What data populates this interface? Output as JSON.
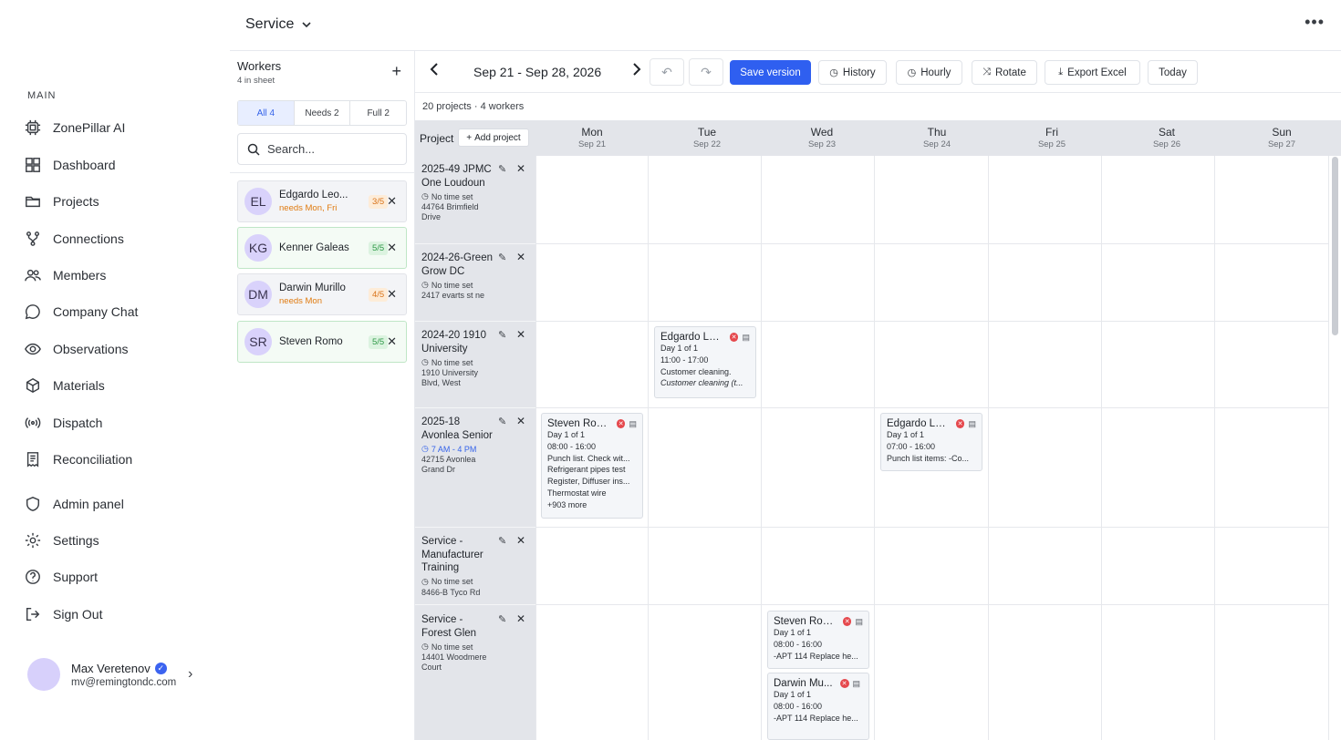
{
  "sidebar": {
    "section_label": "MAIN",
    "items": [
      {
        "label": "ZonePillar AI",
        "icon": "chip-icon"
      },
      {
        "label": "Dashboard",
        "icon": "grid-icon"
      },
      {
        "label": "Projects",
        "icon": "folder-icon"
      },
      {
        "label": "Connections",
        "icon": "branch-icon"
      },
      {
        "label": "Members",
        "icon": "people-icon"
      },
      {
        "label": "Company Chat",
        "icon": "chat-icon"
      },
      {
        "label": "Observations",
        "icon": "eye-icon"
      },
      {
        "label": "Materials",
        "icon": "box-icon"
      },
      {
        "label": "Dispatch",
        "icon": "broadcast-icon"
      },
      {
        "label": "Reconciliation",
        "icon": "receipt-icon"
      },
      {
        "label": "Admin panel",
        "icon": "shield-icon"
      },
      {
        "label": "Settings",
        "icon": "gear-icon"
      },
      {
        "label": "Support",
        "icon": "help-icon"
      },
      {
        "label": "Sign Out",
        "icon": "logout-icon"
      }
    ],
    "user": {
      "name": "Max Veretenov",
      "email": "mv@remingtondc.com"
    }
  },
  "header": {
    "title": "Service",
    "more": "•••"
  },
  "workers": {
    "title": "Workers",
    "subtitle": "4 in sheet",
    "filters": [
      "All 4",
      "Needs 2",
      "Full 2"
    ],
    "search_placeholder": "Search...",
    "list": [
      {
        "initials": "EL",
        "name": "Edgardo Leo...",
        "needs": "needs Mon, Fri",
        "badge": "3/5",
        "status": "warn"
      },
      {
        "initials": "KG",
        "name": "Kenner Galeas",
        "needs": "",
        "badge": "5/5",
        "status": "ok"
      },
      {
        "initials": "DM",
        "name": "Darwin Murillo",
        "needs": "needs Mon",
        "badge": "4/5",
        "status": "warn"
      },
      {
        "initials": "SR",
        "name": "Steven Romo",
        "needs": "",
        "badge": "5/5",
        "status": "ok"
      }
    ]
  },
  "toolbar": {
    "range": "Sep 21 - Sep 28, 2026",
    "save_label": "Save version",
    "history_label": "History",
    "hourly_label": "Hourly",
    "rotate_label": "Rotate",
    "export_label": "Export Excel",
    "today_label": "Today"
  },
  "summary": "20 projects · 4 workers",
  "grid": {
    "project_header": "Project",
    "add_project": "Add project",
    "days": [
      {
        "day": "Mon",
        "date": "Sep 21"
      },
      {
        "day": "Tue",
        "date": "Sep 22"
      },
      {
        "day": "Wed",
        "date": "Sep 23"
      },
      {
        "day": "Thu",
        "date": "Sep 24"
      },
      {
        "day": "Fri",
        "date": "Sep 25"
      },
      {
        "day": "Sat",
        "date": "Sep 26"
      },
      {
        "day": "Sun",
        "date": "Sep 27"
      }
    ],
    "projects": [
      {
        "name": "2025-49 JPMC One Loudoun",
        "time": "No time set",
        "address": "44764 Brimfield Drive"
      },
      {
        "name": "2024-26-Green Grow DC",
        "time": "No time set",
        "address": "2417 evarts st ne"
      },
      {
        "name": "2024-20 1910 University",
        "time": "No time set",
        "address": "1910 University Blvd, West"
      },
      {
        "name": "2025-18 Avonlea Senior",
        "time": "7 AM - 4 PM",
        "address": "42715 Avonlea Grand Dr"
      },
      {
        "name": "Service - Manufacturer Training",
        "time": "No time set",
        "address": "8466-B Tyco Rd"
      },
      {
        "name": "Service - Forest Glen",
        "time": "No time set",
        "address": "14401 Woodmere Court"
      }
    ],
    "cards": [
      {
        "worker": "Edgardo Le...",
        "lines": [
          "Day 1 of 1",
          "11:00 - 17:00",
          "Customer cleaning.",
          "Customer cleaning (t..."
        ]
      },
      {
        "worker": "Steven Romo",
        "lines": [
          "Day 1 of 1",
          "08:00 - 16:00",
          "Punch list. Check wit...",
          "Refrigerant pipes test",
          "Register, Diffuser ins...",
          "Thermostat wire",
          "+903 more"
        ]
      },
      {
        "worker": "Edgardo Le...",
        "lines": [
          "Day 1 of 1",
          "07:00 - 16:00",
          "Punch list items: -Co..."
        ]
      },
      {
        "worker": "Steven Romo",
        "lines": [
          "Day 1 of 1",
          "08:00 - 16:00",
          "-APT 114 Replace he..."
        ]
      },
      {
        "worker": "Darwin Mu...",
        "lines": [
          "Day 1 of 1",
          "08:00 - 16:00",
          "-APT 114 Replace he..."
        ]
      }
    ]
  }
}
